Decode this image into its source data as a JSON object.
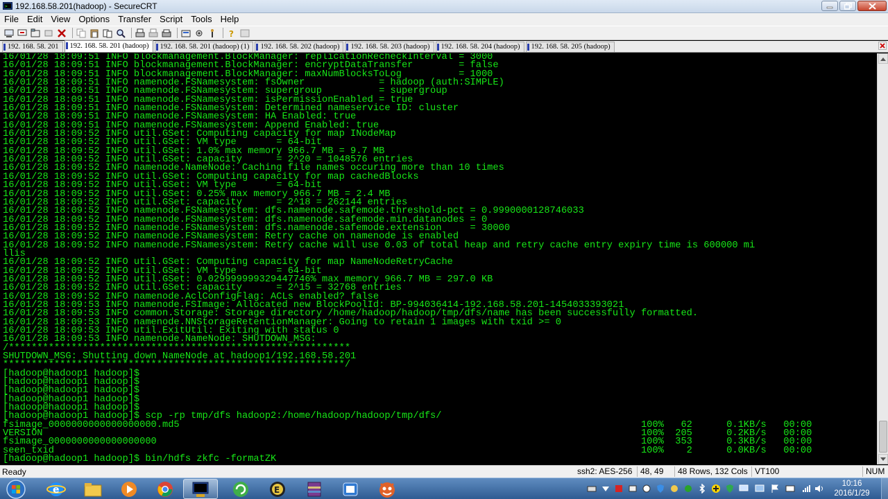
{
  "window": {
    "title": "192.168.58.201(hadoop) - SecureCRT"
  },
  "menu": [
    "File",
    "Edit",
    "View",
    "Options",
    "Transfer",
    "Script",
    "Tools",
    "Help"
  ],
  "toolbar_icons": [
    "connect-icon",
    "quick-connect-icon",
    "connect-tab-icon",
    "reconnect-icon",
    "disconnect-icon",
    "copy-icon",
    "paste-icon",
    "copy-paste-icon",
    "find-icon",
    "print-icon",
    "print-selection-icon",
    "print-setup-icon",
    "session-options-icon",
    "global-options-icon",
    "keymap-icon",
    "help-icon",
    "about-icon"
  ],
  "tabs": [
    {
      "label": "192. 168. 58. 201",
      "active": false
    },
    {
      "label": "192. 168. 58. 201 (hadoop)",
      "active": true
    },
    {
      "label": "192. 168. 58. 201 (hadoop)   (1)",
      "active": false
    },
    {
      "label": "192. 168. 58. 202 (hadoop)",
      "active": false
    },
    {
      "label": "192. 168. 58. 203 (hadoop)",
      "active": false
    },
    {
      "label": "192. 168. 58. 204 (hadoop)",
      "active": false
    },
    {
      "label": "192. 168. 58. 205 (hadoop)",
      "active": false
    }
  ],
  "terminal": {
    "color": "#17e617",
    "lines": [
      "16/01/28 18:09:51 INFO blockmanagement.BlockManager: replicationRecheckInterval = 3000",
      "16/01/28 18:09:51 INFO blockmanagement.BlockManager: encryptDataTransfer        = false",
      "16/01/28 18:09:51 INFO blockmanagement.BlockManager: maxNumBlocksToLog          = 1000",
      "16/01/28 18:09:51 INFO namenode.FSNamesystem: fsOwner             = hadoop (auth:SIMPLE)",
      "16/01/28 18:09:51 INFO namenode.FSNamesystem: supergroup          = supergroup",
      "16/01/28 18:09:51 INFO namenode.FSNamesystem: isPermissionEnabled = true",
      "16/01/28 18:09:51 INFO namenode.FSNamesystem: Determined nameservice ID: cluster",
      "16/01/28 18:09:51 INFO namenode.FSNamesystem: HA Enabled: true",
      "16/01/28 18:09:51 INFO namenode.FSNamesystem: Append Enabled: true",
      "16/01/28 18:09:52 INFO util.GSet: Computing capacity for map INodeMap",
      "16/01/28 18:09:52 INFO util.GSet: VM type       = 64-bit",
      "16/01/28 18:09:52 INFO util.GSet: 1.0% max memory 966.7 MB = 9.7 MB",
      "16/01/28 18:09:52 INFO util.GSet: capacity      = 2^20 = 1048576 entries",
      "16/01/28 18:09:52 INFO namenode.NameNode: Caching file names occuring more than 10 times",
      "16/01/28 18:09:52 INFO util.GSet: Computing capacity for map cachedBlocks",
      "16/01/28 18:09:52 INFO util.GSet: VM type       = 64-bit",
      "16/01/28 18:09:52 INFO util.GSet: 0.25% max memory 966.7 MB = 2.4 MB",
      "16/01/28 18:09:52 INFO util.GSet: capacity      = 2^18 = 262144 entries",
      "16/01/28 18:09:52 INFO namenode.FSNamesystem: dfs.namenode.safemode.threshold-pct = 0.9990000128746033",
      "16/01/28 18:09:52 INFO namenode.FSNamesystem: dfs.namenode.safemode.min.datanodes = 0",
      "16/01/28 18:09:52 INFO namenode.FSNamesystem: dfs.namenode.safemode.extension     = 30000",
      "16/01/28 18:09:52 INFO namenode.FSNamesystem: Retry cache on namenode is enabled",
      "16/01/28 18:09:52 INFO namenode.FSNamesystem: Retry cache will use 0.03 of total heap and retry cache entry expiry time is 600000 mi",
      "llis",
      "16/01/28 18:09:52 INFO util.GSet: Computing capacity for map NameNodeRetryCache",
      "16/01/28 18:09:52 INFO util.GSet: VM type       = 64-bit",
      "16/01/28 18:09:52 INFO util.GSet: 0.029999999329447746% max memory 966.7 MB = 297.0 KB",
      "16/01/28 18:09:52 INFO util.GSet: capacity      = 2^15 = 32768 entries",
      "16/01/28 18:09:52 INFO namenode.AclConfigFlag: ACLs enabled? false",
      "16/01/28 18:09:53 INFO namenode.FSImage: Allocated new BlockPoolId: BP-994036414-192.168.58.201-1454033393021",
      "16/01/28 18:09:53 INFO common.Storage: Storage directory /home/hadoop/hadoop/tmp/dfs/name has been successfully formatted.",
      "16/01/28 18:09:53 INFO namenode.NNStorageRetentionManager: Going to retain 1 images with txid >= 0",
      "16/01/28 18:09:53 INFO util.ExitUtil: Exiting with status 0",
      "16/01/28 18:09:53 INFO namenode.NameNode: SHUTDOWN_MSG:",
      "/************************************************************",
      "SHUTDOWN_MSG: Shutting down NameNode at hadoop1/192.168.58.201",
      "************************************************************/",
      "[hadoop@hadoop1 hadoop]$",
      "[hadoop@hadoop1 hadoop]$",
      "[hadoop@hadoop1 hadoop]$",
      "[hadoop@hadoop1 hadoop]$",
      "[hadoop@hadoop1 hadoop]$",
      "[hadoop@hadoop1 hadoop]$ scp -rp tmp/dfs hadoop2:/home/hadoop/hadoop/tmp/dfs/",
      "fsimage_0000000000000000000.md5                                                                                 100%   62      0.1KB/s   00:00",
      "VERSION                                                                                                         100%  205      0.2KB/s   00:00",
      "fsimage_0000000000000000000                                                                                     100%  353      0.3KB/s   00:00",
      "seen_txid                                                                                                       100%    2      0.0KB/s   00:00",
      "[hadoop@hadoop1 hadoop]$ bin/hdfs zkfc -formatZK"
    ]
  },
  "status": {
    "ready": "Ready",
    "cipher": "ssh2: AES-256",
    "cursor": "48, 49",
    "size": "48 Rows, 132 Cols",
    "emulation": "VT100",
    "num": "NUM"
  },
  "taskbar": {
    "apps": [
      "start-orb-icon",
      "internet-explorer-icon",
      "file-explorer-icon",
      "media-player-icon",
      "chrome-icon",
      "securecrt-icon",
      "refresh-tool-icon",
      "green-app-icon",
      "winrar-icon",
      "blue-app-icon",
      "mascot-app-icon"
    ],
    "time": "10:16",
    "date": "2016/1/29"
  }
}
